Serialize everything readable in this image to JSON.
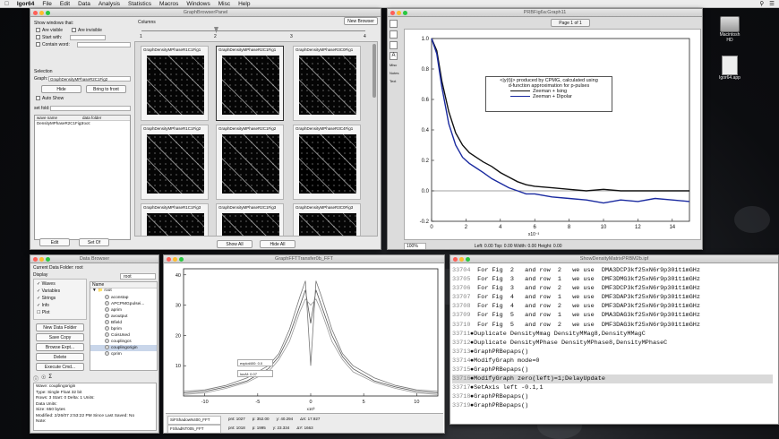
{
  "menubar": {
    "app": "Igor64",
    "items": [
      "File",
      "Edit",
      "Data",
      "Analysis",
      "Statistics",
      "Macros",
      "Windows",
      "Misc",
      "Help"
    ]
  },
  "browser_panel": {
    "title": "GraphBrowserPanel",
    "show_label": "Show windows that:",
    "not_visible": "Are visible",
    "any_visible": "Are invisible",
    "start_with": "Start with:",
    "contain_word": "Contain word:",
    "columns_label": "Columns",
    "columns_ticks": [
      "1",
      "2",
      "3",
      "4"
    ],
    "new_browser": "New Browser",
    "selection": "Selection",
    "graph_label": "Graph:",
    "graph_value": "GraphDensityMPhaseR2C1Fig2",
    "hide": "Hide",
    "bring_to_front": "Bring to front",
    "auto_show": "Auto Show",
    "set_fold": "set fold:",
    "wave_col": "wave name",
    "folder_col": "data folder",
    "wave_item": "DensityMPhaseR2C1Fig2",
    "folder_item": "root:",
    "edit": "Edit",
    "set_of": "Set Of",
    "show_all": "Show All",
    "hide_all": "Hide All",
    "thumbs": [
      "GraphDensityMPhaseR1C1Fig1",
      "GraphDensityMPhaseR2C1Fig1",
      "GraphDensityMPhaseR3C0Fig1",
      "GraphDensityMPhaseR1C1Fig2",
      "GraphDensityMPhaseR2C1Fig2",
      "GraphDensityMPhaseR3C4Fig1",
      "GraphDensityMPhaseR1C1Fig3",
      "GraphDensityMPhaseR2C1Fig3",
      "GraphDensityMPhaseR3C0Fig3"
    ]
  },
  "main_graph": {
    "title": "PRBFig6a:Graph11",
    "page": "Page 1 of 1",
    "legend_title": "<|y(t)|> produced by CPMG, calculated using",
    "legend_sub": "d-function approximation for p-pulses",
    "legend_items": [
      {
        "name": "Zeeman + Ising",
        "color": "#111111"
      },
      {
        "name": "Zeeman + Dipolar",
        "color": "#1a2aa0"
      }
    ],
    "xunit": "x10⁻³",
    "zoom": "100%",
    "status": "Left: 0.00  Top: 0.00  Width: 0.00  Height: 0.00",
    "side_tools": [
      "A",
      "Misc",
      "Notes",
      "Text"
    ]
  },
  "chart_data": [
    {
      "type": "line",
      "title": "<|y(t)|> produced by CPMG, calculated using d-function approximation for p-pulses",
      "xlabel": "",
      "xunit": "x10⁻³",
      "ylabel": "",
      "xlim": [
        0,
        15
      ],
      "ylim": [
        -0.2,
        1.0
      ],
      "x_ticks": [
        "0",
        "2",
        "4",
        "6",
        "8",
        "10",
        "12",
        "14"
      ],
      "y_ticks": [
        "1.0",
        "0.8",
        "0.6",
        "0.4",
        "0.2",
        "0.0",
        "-0.2"
      ],
      "grid": false,
      "legend": "center-right",
      "series": [
        {
          "name": "Zeeman + Ising",
          "x": [
            0,
            0.3,
            0.6,
            1,
            1.4,
            1.8,
            2.2,
            2.6,
            3,
            3.5,
            4,
            4.5,
            5,
            5.5,
            6,
            7,
            8,
            9,
            10,
            11,
            12,
            13,
            14,
            15
          ],
          "y": [
            1.0,
            0.92,
            0.72,
            0.52,
            0.38,
            0.3,
            0.25,
            0.22,
            0.19,
            0.16,
            0.12,
            0.09,
            0.06,
            0.04,
            0.03,
            0.02,
            0.01,
            0.0,
            0.01,
            0.0,
            0.0,
            0.0,
            0.0,
            0.0
          ]
        },
        {
          "name": "Zeeman + Dipolar",
          "x": [
            0,
            0.3,
            0.6,
            1,
            1.4,
            1.8,
            2.2,
            2.6,
            3,
            3.5,
            4,
            4.5,
            5,
            5.5,
            6,
            7,
            8,
            9,
            10,
            11,
            12,
            13,
            14,
            15
          ],
          "y": [
            1.0,
            0.9,
            0.68,
            0.44,
            0.3,
            0.22,
            0.18,
            0.15,
            0.12,
            0.08,
            0.05,
            0.02,
            0.0,
            -0.02,
            -0.02,
            -0.04,
            -0.05,
            -0.06,
            -0.08,
            -0.06,
            -0.07,
            -0.05,
            -0.06,
            -0.07
          ]
        }
      ]
    },
    {
      "type": "line",
      "title": "",
      "xlabel": "",
      "xunit": "x10³",
      "xlim": [
        -12,
        12
      ],
      "ylim": [
        0,
        42
      ],
      "x_ticks": [
        "-10",
        "-5",
        "0",
        "5",
        "10"
      ],
      "y_ticks": [
        "40",
        "30",
        "20",
        "10"
      ],
      "series": [
        {
          "x": [
            -12,
            -10,
            -8,
            -6,
            -4,
            -3,
            -2,
            -1,
            -0.5,
            0,
            0.5,
            1,
            2,
            3,
            4,
            6,
            8,
            10,
            12
          ],
          "y": [
            1,
            1.5,
            3,
            5,
            9,
            13,
            20,
            30,
            35,
            24,
            35,
            30,
            20,
            13,
            9,
            5,
            3,
            1.5,
            1
          ]
        },
        {
          "x": [
            -12,
            -10,
            -8,
            -6,
            -4,
            -3,
            -2,
            -1,
            -0.5,
            0,
            0.5,
            1,
            2,
            3,
            4,
            6,
            8,
            10,
            12
          ],
          "y": [
            1.5,
            2,
            3.5,
            6,
            10,
            14,
            22,
            33,
            38,
            10,
            38,
            33,
            22,
            14,
            10,
            6,
            3.5,
            2,
            1.5
          ]
        },
        {
          "x": [
            -12,
            -10,
            -8,
            -6,
            -4,
            -3,
            -2,
            -1,
            -0.5,
            0,
            0.5,
            1,
            2,
            3,
            4,
            6,
            8,
            10,
            12
          ],
          "y": [
            0.5,
            1,
            2.5,
            4.5,
            8,
            12,
            18,
            28,
            32,
            30,
            32,
            28,
            18,
            12,
            8,
            4.5,
            2.5,
            1,
            0.5
          ]
        }
      ]
    }
  ],
  "data_browser": {
    "title": "Data Browser",
    "current_folder_label": "Current Data Folder:",
    "current_folder": "root",
    "display": "Display",
    "checks": [
      "Waves",
      "Variables",
      "Strings",
      "Info",
      "Plot"
    ],
    "buttons": [
      "New Data Folder",
      "Save Copy",
      "Browse Expt...",
      "Delete",
      "Execute Cmd..."
    ],
    "root_select": "root",
    "name_col": "Name",
    "tree_root": "root",
    "items": [
      "aconstap",
      "APCPMGpulsei...",
      "aprim",
      "avoutput",
      "Bfield",
      "bprim",
      "CoisUsed",
      "couplingcs",
      "couplingorigin",
      "cprim"
    ],
    "info": [
      "Wave: couplingorigin",
      "Type: Single Float 32 bit",
      "Rows: 3  Start: 0  Delta: 1  Units:",
      "Data Units:",
      "Size: 650 bytes",
      "Modified: 2/26/07 2:53:22 PM  Since Last Saved: No",
      "Note:"
    ]
  },
  "fft_graph": {
    "title": "GraphFFTTransfer0b_FFT",
    "box1_label": "explot400:",
    "box1_value": "0.0",
    "box2_label": "locAf:",
    "box2_value": "0.07",
    "cursor_a": "SiFShadowN400_FFT",
    "cursor_b": "FShadNT005_FFT",
    "pnt_a": "pnt: 1027",
    "pnt_b": "pnt: 1018",
    "p_a": "p: 352.00",
    "p_b": "p: 1995",
    "y_a": "y: 40.294",
    "y_b": "y: 23.334",
    "dx_a": "ΔX: 17.927",
    "dx_b": "ΔY: 1663"
  },
  "procedure": {
    "title": "ShowDensityMatrixPRBM2b.ipf",
    "lines": [
      {
        "n": "33704",
        "t": "  For Fig  2   and row  2   we use  DMA3DCP3kf25xN6r9p301t1mGHz"
      },
      {
        "n": "33705",
        "t": "  For Fig  3   and row  1   we use  DMF3DMG3kf25xN6r9p301t1mGHz"
      },
      {
        "n": "33706",
        "t": "  For Fig  3   and row  2   we use  DMF3DCP3kf25xN6r9p301t1mGHz"
      },
      {
        "n": "33707",
        "t": "  For Fig  4   and row  1   we use  DMF3DAP3kf25xN6r9p301t1mGHz"
      },
      {
        "n": "33708",
        "t": "  For Fig  4   and row  2   we use  DMF3DAP3kf25xN6r9p301t1mGHz"
      },
      {
        "n": "33709",
        "t": "  For Fig  5   and row  1   we use  DMA3DAG3kf25xN6r9p301t1mGHz"
      },
      {
        "n": "33710",
        "t": "  For Fig  5   and row  2   we use  DMF3DAG3kf25xN6r9p301t1mGHz"
      },
      {
        "n": "33711",
        "t": "●Duplicate DensityMmag DensityMMag8,DensityMMagC"
      },
      {
        "n": "33712",
        "t": "●Duplicate DensityMPhase DensityMPhase8,DensityMPhaseC"
      },
      {
        "n": "33713",
        "t": "●GraphPRBepaps()"
      },
      {
        "n": "33714",
        "t": "●ModifyGraph mode=0"
      },
      {
        "n": "33715",
        "t": "●GraphPRBepaps()"
      },
      {
        "n": "33716",
        "t": "●ModifyGraph zero(left)=1;DelayUpdate",
        "hl": true
      },
      {
        "n": "33717",
        "t": "●SetAxis left -0.1,1"
      },
      {
        "n": "33718",
        "t": "●GraphPRBepaps()"
      },
      {
        "n": "33719",
        "t": "●GraphPRBepaps()"
      }
    ]
  },
  "desktop": {
    "hd": "Macintosh HD",
    "app": "Igor64.app"
  }
}
